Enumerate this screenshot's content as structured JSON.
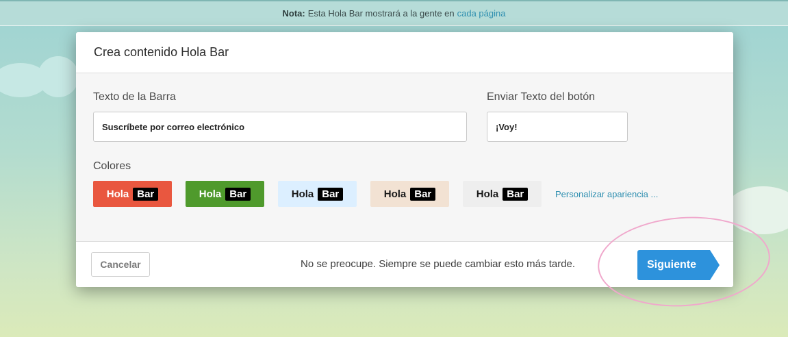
{
  "notice": {
    "bold": "Nota:",
    "text": "Esta Hola Bar mostrará a la gente en",
    "link": "cada página"
  },
  "modal": {
    "title": "Crea contenido Hola Bar",
    "bar_text_label": "Texto de la Barra",
    "bar_text_value": "Suscríbete por correo electrónico",
    "button_text_label": "Enviar Texto del botón",
    "button_text_value": "¡Voy!",
    "colors_label": "Colores",
    "swatches": [
      {
        "label": "Hola",
        "tag": "Bar",
        "bg": "#e9573f",
        "fg": "#ffffff"
      },
      {
        "label": "Hola",
        "tag": "Bar",
        "bg": "#4f9a2c",
        "fg": "#ffffff"
      },
      {
        "label": "Hola",
        "tag": "Bar",
        "bg": "#dcefff",
        "fg": "#1a1a1a"
      },
      {
        "label": "Hola",
        "tag": "Bar",
        "bg": "#f2e2d3",
        "fg": "#1a1a1a"
      },
      {
        "label": "Hola",
        "tag": "Bar",
        "bg": "#eeeeee",
        "fg": "#1a1a1a"
      }
    ],
    "customize_link": "Personalizar apariencia ...",
    "footer": {
      "cancel": "Cancelar",
      "note": "No se preocupe. Siempre se puede cambiar esto más tarde.",
      "next": "Siguiente"
    }
  },
  "colors": {
    "link": "#2f8fb0",
    "primary_button": "#2d92dc",
    "annotation_circle": "#f0a8cc"
  }
}
